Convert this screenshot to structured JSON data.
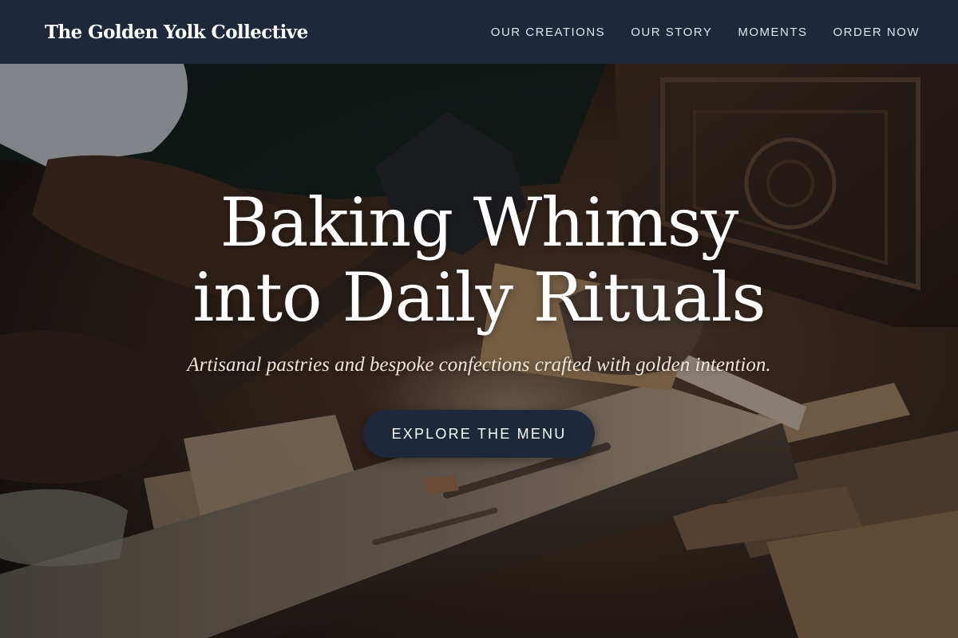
{
  "brand": {
    "name": "The Golden Yolk Collective"
  },
  "nav": {
    "items": [
      {
        "label": "OUR CREATIONS"
      },
      {
        "label": "OUR STORY"
      },
      {
        "label": "MOMENTS"
      },
      {
        "label": "ORDER NOW"
      }
    ]
  },
  "hero": {
    "title_line1": "Baking Whimsy",
    "title_line2": "into Daily Rituals",
    "subtitle": "Artisanal pastries and bespoke confections crafted with golden intention.",
    "cta_label": "EXPLORE THE MENU",
    "background_image": "photo-woodcarving-artisan-hands-with-chisel-and-mallet"
  },
  "colors": {
    "header_bg": "#1d283b",
    "cta_bg": "#1d283b",
    "text_light": "#ffffff"
  }
}
